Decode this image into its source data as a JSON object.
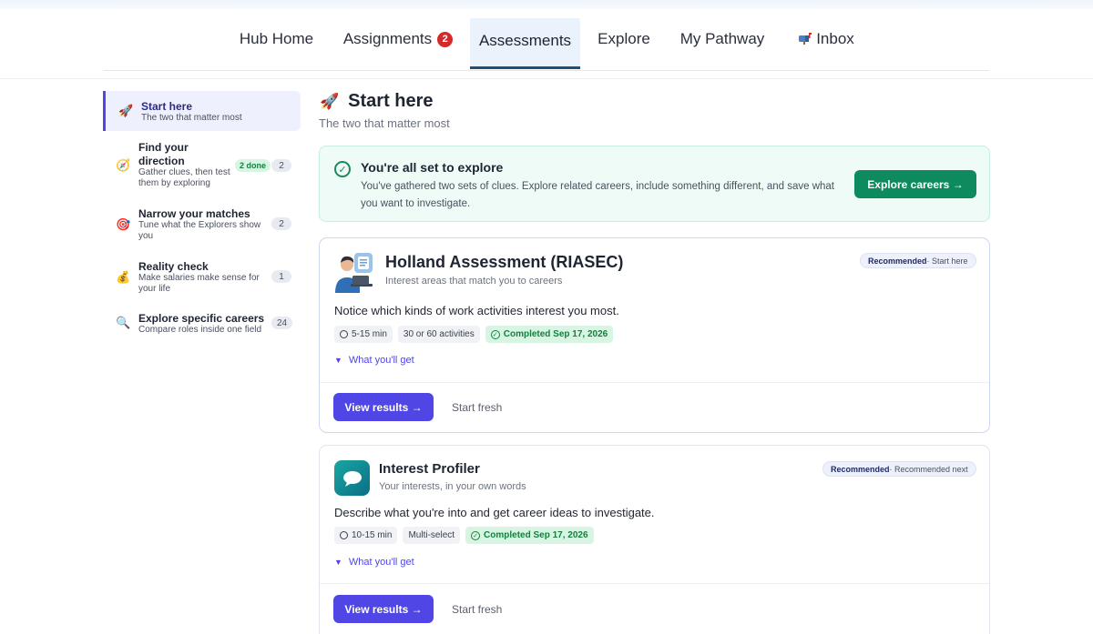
{
  "nav": {
    "items": [
      {
        "label": "Hub Home"
      },
      {
        "label": "Assignments",
        "badge": "2"
      },
      {
        "label": "Assessments"
      },
      {
        "label": "Explore"
      },
      {
        "label": "My Pathway"
      },
      {
        "label": "Inbox",
        "icon": "mailbox-icon"
      }
    ],
    "active": "Assessments"
  },
  "sidebar": {
    "items": [
      {
        "icon": "rocket-icon",
        "title": "Start here",
        "subtitle": "The two that matter most"
      },
      {
        "icon": "compass-icon",
        "title_line1": "Find your",
        "title_line2": "direction",
        "subtitle_line1": "Gather clues, then test",
        "subtitle_line2": "them by exploring",
        "done": "2 done",
        "count": "2"
      },
      {
        "icon": "target-icon",
        "title": "Narrow your matches",
        "subtitle_line1": "Tune what the Explorers show",
        "subtitle_line2": "you",
        "count": "2"
      },
      {
        "icon": "money-bag-icon",
        "title": "Reality check",
        "subtitle_line1": "Make salaries make sense for",
        "subtitle_line2": "your life",
        "count": "1"
      },
      {
        "icon": "magnifier-icon",
        "title": "Explore specific careers",
        "subtitle": "Compare roles inside one field",
        "count": "24"
      }
    ]
  },
  "main": {
    "title": "Start here",
    "subtitle": "The two that matter most"
  },
  "banner": {
    "title": "You're all set to explore",
    "text": "You've gathered two sets of clues. Explore related careers, include something different, and save what you want to investigate.",
    "button": "Explore careers →"
  },
  "cards": [
    {
      "title": "Holland Assessment (RIASEC)",
      "subtitle": "Interest areas that match you to careers",
      "rec_strong": "Recommended",
      "rec_rest": " · Start here",
      "description": "Notice which kinds of work activities interest you most.",
      "chip_time": "5-15 min",
      "chip_format": "30 or 60 activities",
      "chip_status": "Completed Sep 17, 2026",
      "what": "What you'll get",
      "primary": "View results →",
      "secondary": "Start fresh"
    },
    {
      "title": "Interest Profiler",
      "subtitle": "Your interests, in your own words",
      "rec_strong": "Recommended",
      "rec_rest": " · Recommended next",
      "description": "Describe what you're into and get career ideas to investigate.",
      "chip_time": "10-15 min",
      "chip_format": "Multi-select",
      "chip_status": "Completed Sep 17, 2026",
      "what": "What you'll get",
      "primary": "View results →",
      "secondary": "Start fresh"
    }
  ],
  "colors": {
    "accent": "#4f46e5",
    "success": "#0e8a5f",
    "badge": "#d42a2a",
    "nav_active_border": "#1e4e7a"
  }
}
